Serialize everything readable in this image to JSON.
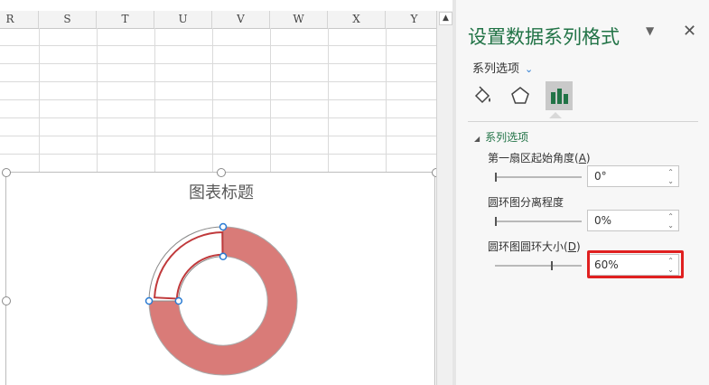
{
  "sheet": {
    "columns": [
      "R",
      "S",
      "T",
      "U",
      "V",
      "W",
      "X",
      "Y"
    ]
  },
  "chart": {
    "title": "图表标题",
    "chart_data": {
      "type": "pie",
      "subtype": "doughnut",
      "title": "图表标题",
      "hole_size_percent": 60,
      "first_slice_angle_deg": 0,
      "explosion_percent": 0,
      "colors": [
        "#d97b78",
        "#ffffff"
      ]
    }
  },
  "pane": {
    "title": "设置数据系列格式",
    "series_selector": "系列选项",
    "section_title": "系列选项",
    "options": [
      {
        "label": "第一扇区起始角度",
        "hotkey": "A",
        "value": "0°"
      },
      {
        "label": "圆环图分离程度",
        "hotkey": "",
        "value": "0%"
      },
      {
        "label": "圆环图圆环大小",
        "hotkey": "D",
        "value": "60%"
      }
    ]
  },
  "icons": {
    "close": "close-icon",
    "dropdown": "chevron-down-icon",
    "fill": "paint-bucket-icon",
    "effects": "pentagon-icon",
    "series": "bar-chart-icon"
  },
  "colors": {
    "accent": "#217346",
    "highlight": "#e02020",
    "series_fill": "#d97b78",
    "selected_outline": "#c0393b"
  }
}
